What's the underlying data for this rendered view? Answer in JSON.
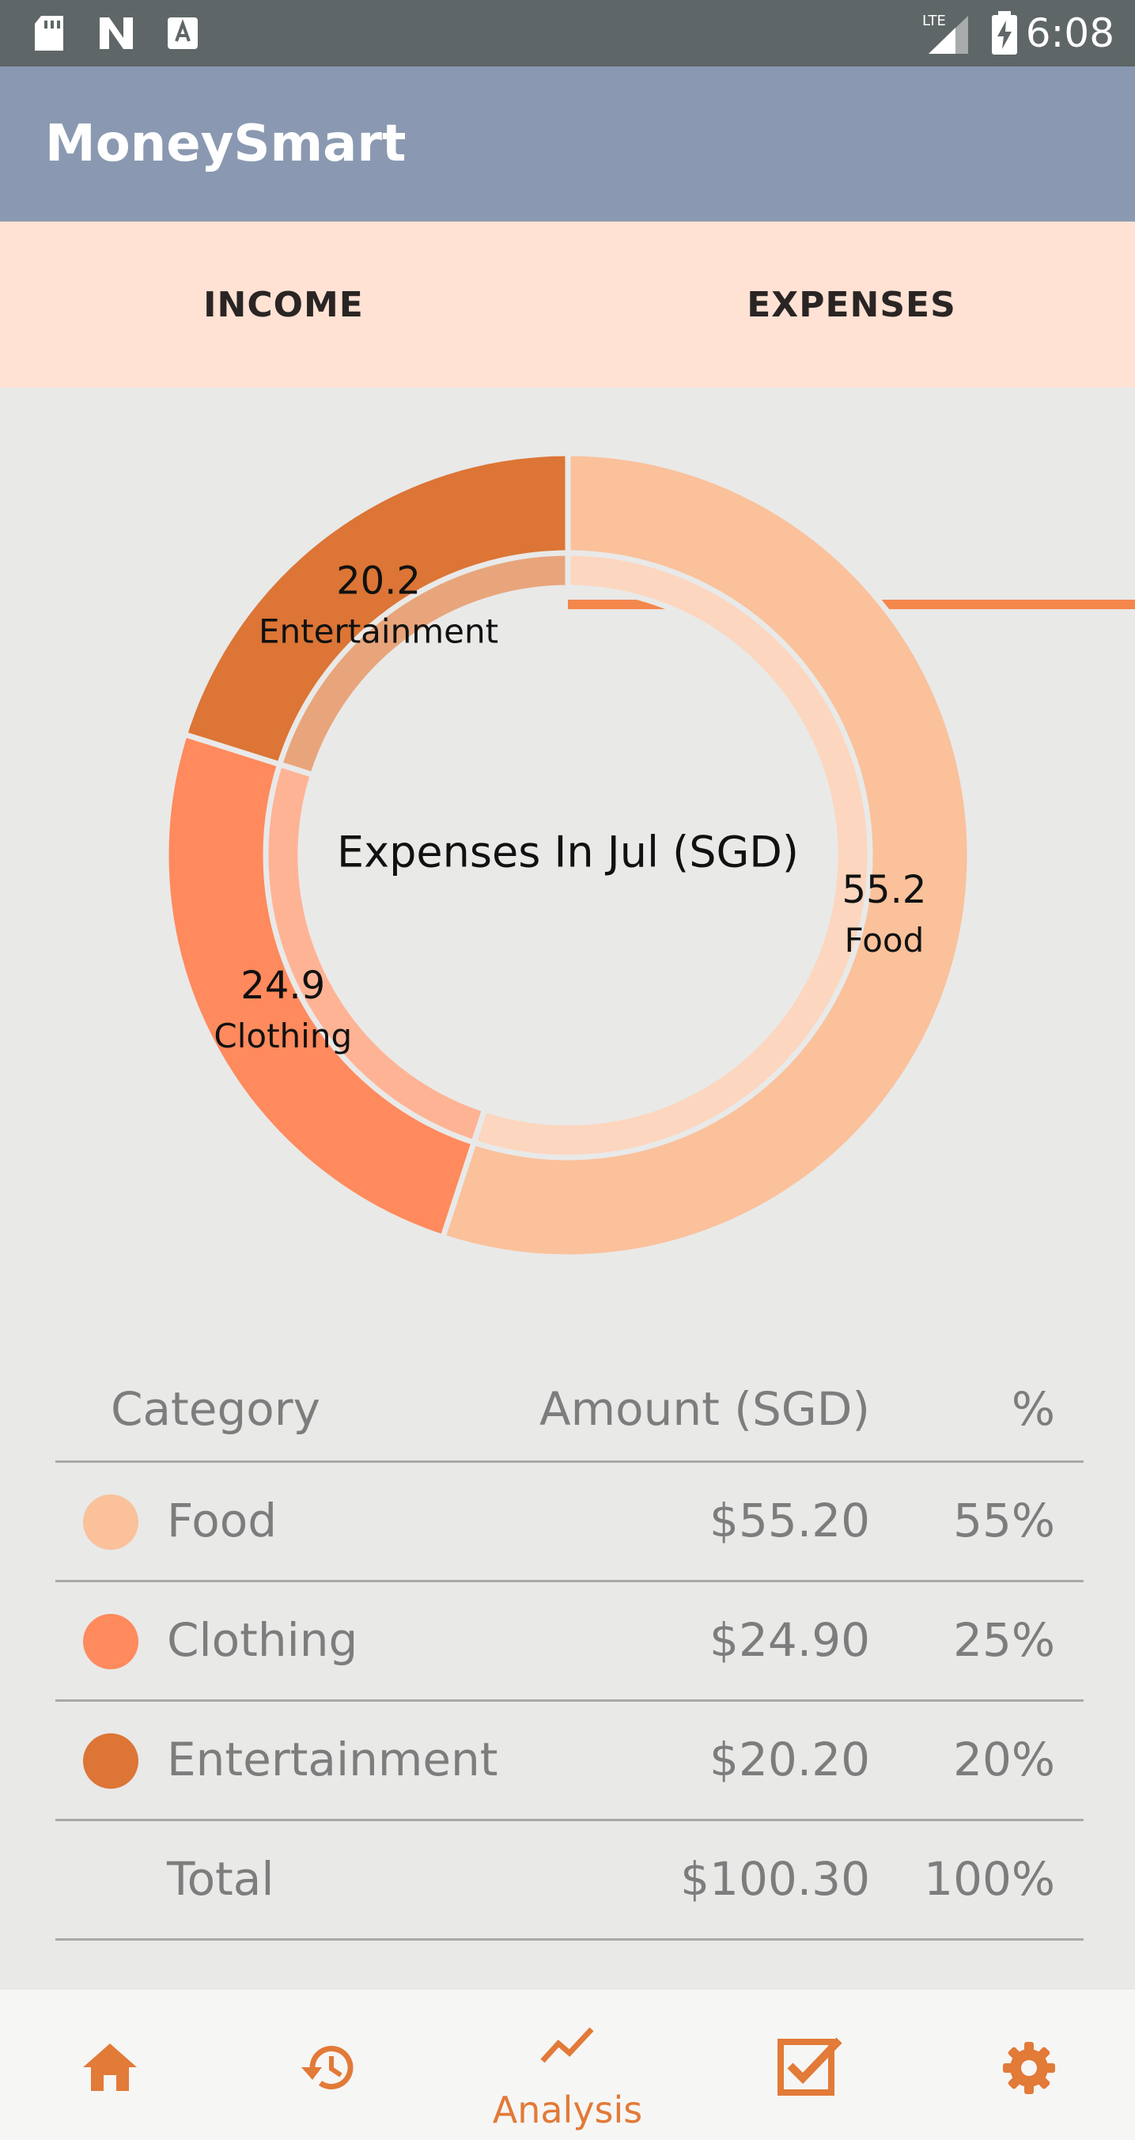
{
  "status_bar": {
    "time": "6:08",
    "network_label": "LTE"
  },
  "app": {
    "title": "MoneySmart"
  },
  "tabs": [
    {
      "label": "INCOME",
      "selected": false
    },
    {
      "label": "EXPENSES",
      "selected": true
    }
  ],
  "colors": {
    "accent": "#f3874c",
    "food": "#fac19b",
    "clothing": "#fe8a5d",
    "entertainment": "#dc7535"
  },
  "chart_data": {
    "type": "pie",
    "title": "Expenses In Jul (SGD)",
    "slices": [
      {
        "label": "Food",
        "value": 55.2,
        "display": "55.2",
        "color": "#fac19b"
      },
      {
        "label": "Clothing",
        "value": 24.9,
        "display": "24.9",
        "color": "#fe8a5d"
      },
      {
        "label": "Entertainment",
        "value": 20.2,
        "display": "20.2",
        "color": "#dc7535"
      }
    ]
  },
  "table": {
    "headers": {
      "category": "Category",
      "amount": "Amount (SGD)",
      "percent": "%"
    },
    "rows": [
      {
        "category": "Food",
        "amount": "$55.20",
        "percent": "55%",
        "color": "#fac19b"
      },
      {
        "category": "Clothing",
        "amount": "$24.90",
        "percent": "25%",
        "color": "#fe8a5d"
      },
      {
        "category": "Entertainment",
        "amount": "$20.20",
        "percent": "20%",
        "color": "#dc7535"
      }
    ],
    "total": {
      "label": "Total",
      "amount": "$100.30",
      "percent": "100%"
    }
  },
  "bottom_nav": [
    {
      "icon": "home-icon",
      "label": ""
    },
    {
      "icon": "history-icon",
      "label": ""
    },
    {
      "icon": "analysis-icon",
      "label": "Analysis",
      "selected": true
    },
    {
      "icon": "checklist-icon",
      "label": ""
    },
    {
      "icon": "settings-icon",
      "label": ""
    }
  ]
}
